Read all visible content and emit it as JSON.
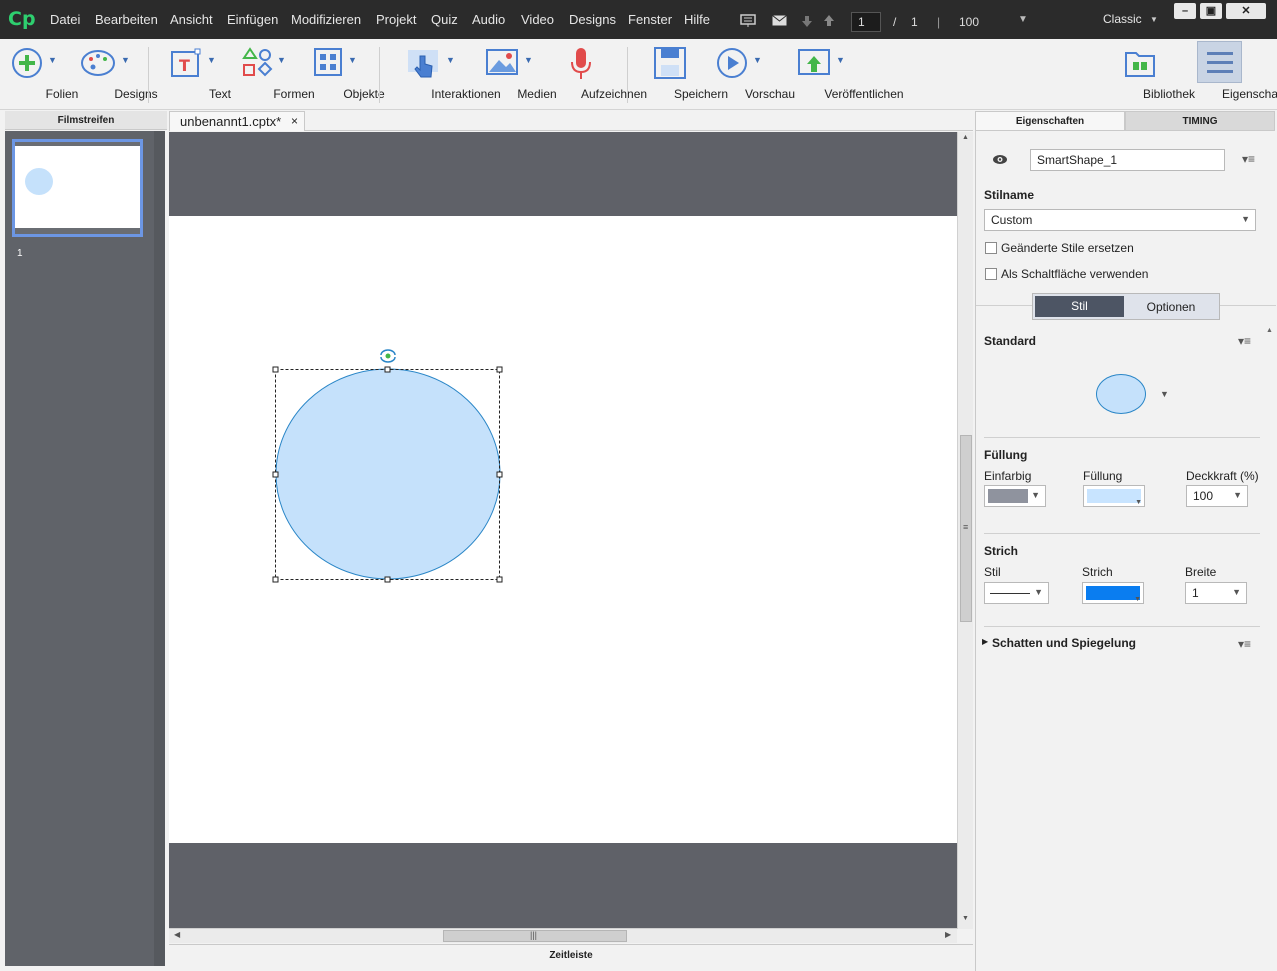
{
  "menubar": {
    "menus": [
      "Datei",
      "Bearbeiten",
      "Ansicht",
      "Einfügen",
      "Modifizieren",
      "Projekt",
      "Quiz",
      "Audio",
      "Video",
      "Designs",
      "Fenster",
      "Hilfe"
    ],
    "page_current": "1",
    "page_sep": "/",
    "page_total": "1",
    "zoom": "100",
    "workspace": "Classic"
  },
  "toolbar": {
    "folien": "Folien",
    "designs": "Designs",
    "text": "Text",
    "formen": "Formen",
    "objekte": "Objekte",
    "interaktionen": "Interaktionen",
    "medien": "Medien",
    "aufzeichnen": "Aufzeichnen",
    "speichern": "Speichern",
    "vorschau": "Vorschau",
    "veroeffentlichen": "Veröffentlichen",
    "bibliothek": "Bibliothek",
    "eigenschaften": "Eigenschaften"
  },
  "filmstrip": {
    "title": "Filmstreifen",
    "slide_number": "1"
  },
  "document": {
    "tab_name": "unbenannt1.cptx*"
  },
  "timeline": {
    "label": "Zeitleiste"
  },
  "properties": {
    "tab_properties": "Eigenschaften",
    "tab_timing": "TIMING",
    "object_name": "SmartShape_1",
    "style_name_label": "Stilname",
    "style_name_value": "Custom",
    "replace_styles": "Geänderte Stile ersetzen",
    "use_as_button": "Als Schaltfläche verwenden",
    "subtab_style": "Stil",
    "subtab_options": "Optionen",
    "standard_label": "Standard",
    "fill_section": "Füllung",
    "fill_type_label": "Einfarbig",
    "fill_label": "Füllung",
    "opacity_label": "Deckkraft (%)",
    "opacity_value": "100",
    "stroke_section": "Strich",
    "stroke_style_label": "Stil",
    "stroke_color_label": "Strich",
    "stroke_width_label": "Breite",
    "stroke_width_value": "1",
    "shadow_section": "Schatten und Spiegelung"
  },
  "colors": {
    "shape_fill": "#c5e1fb",
    "shape_stroke": "#2a86c7",
    "fill_swatch": "#c8e4ff",
    "stroke_swatch": "#0a7df0",
    "fill_type_swatch": "#8f939e",
    "accent": "#4d5564"
  }
}
